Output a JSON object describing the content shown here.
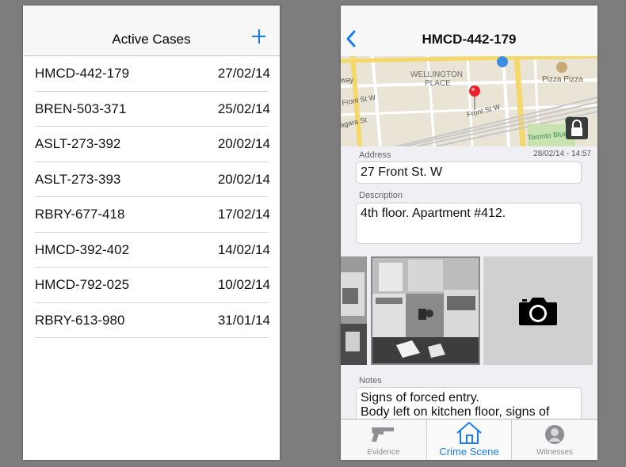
{
  "left": {
    "title": "Active Cases",
    "add_icon": "plus-icon",
    "cases": [
      {
        "id": "HMCD-442-179",
        "date": "27/02/14"
      },
      {
        "id": "BREN-503-371",
        "date": "25/02/14"
      },
      {
        "id": "ASLT-273-392",
        "date": "20/02/14"
      },
      {
        "id": "ASLT-273-393",
        "date": "20/02/14"
      },
      {
        "id": "RBRY-677-418",
        "date": "17/02/14"
      },
      {
        "id": "HMCD-392-402",
        "date": "14/02/14"
      },
      {
        "id": "HMCD-792-025",
        "date": "10/02/14"
      },
      {
        "id": "RBRY-613-980",
        "date": "31/01/14"
      }
    ]
  },
  "right": {
    "title": "HMCD-442-179",
    "map": {
      "labels": {
        "wellington": "WELLINGTON",
        "place": "PLACE",
        "front_st": "Front St W",
        "front_st_2": "Front St W",
        "garage": "agara St",
        "way": "way",
        "pizza": "Pizza Pizza",
        "toronto": "Toronto Blue Jays"
      }
    },
    "timestamp": "28/02/14 - 14:57",
    "address": {
      "label": "Address",
      "value": "27 Front St. W"
    },
    "description": {
      "label": "Description",
      "value": "4th floor. Apartment #412."
    },
    "notes": {
      "label": "Notes",
      "line1": "Signs of forced entry.",
      "line2": "Body left on kitchen floor, signs of"
    },
    "tabs": {
      "evidence": "Evidence",
      "crime_scene": "Crime Scene",
      "witnesses": "Witnesses"
    }
  },
  "colors": {
    "accent": "#1a7cf5",
    "background": "#7d7d7d",
    "map_pin": "#e8232c"
  }
}
